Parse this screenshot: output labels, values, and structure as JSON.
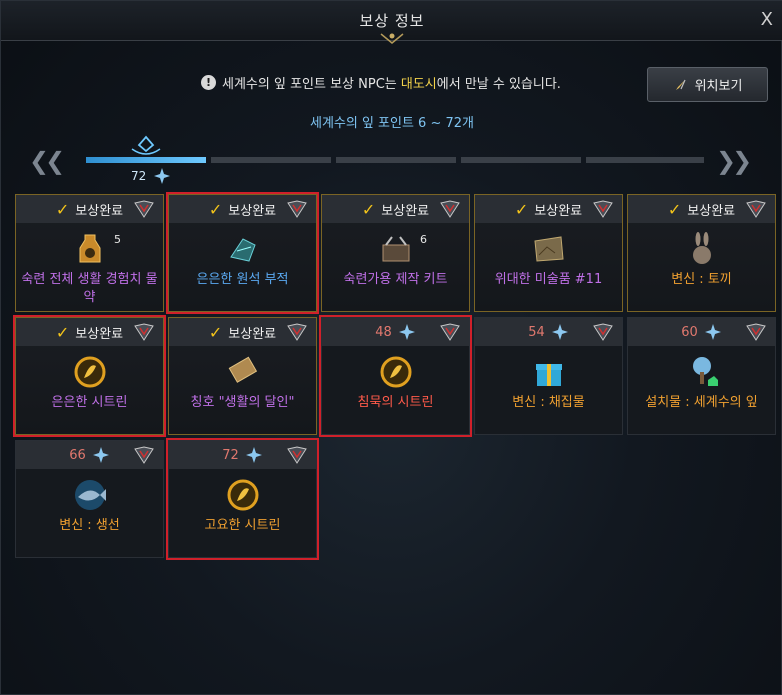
{
  "window": {
    "title": "보상 정보",
    "close_label": "X"
  },
  "notice": {
    "prefix": "세계수의 잎 포인트 보상 NPC는 ",
    "highlight": "대도시",
    "suffix": "에서 만날 수 있습니다."
  },
  "location_button": {
    "label": "위치보기"
  },
  "range_label": "세계수의 잎 포인트 6 ~ 72개",
  "progress": {
    "current_label": "72",
    "segments": 5
  },
  "rewards": [
    {
      "status": "done",
      "status_label": "보상완료",
      "name": "숙련 전체 생활 경험치 물약",
      "qty": "5",
      "name_color": "purple",
      "icon": "potion-icon",
      "selected": false
    },
    {
      "status": "done",
      "status_label": "보상완료",
      "name": "은은한 원석 부적",
      "qty": "",
      "name_color": "blue",
      "icon": "gem-charm-icon",
      "selected": true
    },
    {
      "status": "done",
      "status_label": "보상완료",
      "name": "숙련가용 제작 키트",
      "qty": "6",
      "name_color": "purple",
      "icon": "toolbox-icon",
      "selected": false
    },
    {
      "status": "done",
      "status_label": "보상완료",
      "name": "위대한 미술품 #11",
      "qty": "",
      "name_color": "purple",
      "icon": "painting-icon",
      "selected": false
    },
    {
      "status": "done",
      "status_label": "보상완료",
      "name": "변신 : 토끼",
      "qty": "",
      "name_color": "orange",
      "icon": "rabbit-icon",
      "selected": false
    },
    {
      "status": "done",
      "status_label": "보상완료",
      "name": "은은한 시트린",
      "qty": "",
      "name_color": "purple",
      "icon": "citrine-icon",
      "selected": true
    },
    {
      "status": "done",
      "status_label": "보상완료",
      "name": "칭호 \"생활의 달인\"",
      "qty": "",
      "name_color": "purple",
      "icon": "scroll-icon",
      "selected": false
    },
    {
      "status": "level",
      "level": "48",
      "name": "침묵의 시트린",
      "qty": "",
      "name_color": "red",
      "icon": "citrine-icon",
      "selected": true
    },
    {
      "status": "level",
      "level": "54",
      "name": "변신 : 채집물",
      "qty": "",
      "name_color": "orange",
      "icon": "gift-icon",
      "selected": false
    },
    {
      "status": "level",
      "level": "60",
      "name": "설치물 : 세계수의 잎",
      "qty": "",
      "name_color": "orange",
      "icon": "tree-icon",
      "selected": false
    },
    {
      "status": "level",
      "level": "66",
      "name": "변신 : 생선",
      "qty": "",
      "name_color": "orange",
      "icon": "fish-icon",
      "selected": false
    },
    {
      "status": "level",
      "level": "72",
      "name": "고요한 시트린",
      "qty": "",
      "name_color": "orange",
      "icon": "citrine-icon",
      "selected": true
    }
  ],
  "colors": {
    "accent_blue": "#6ec9ff",
    "selection_red": "#d0202a",
    "done_check": "#f2c31a"
  }
}
